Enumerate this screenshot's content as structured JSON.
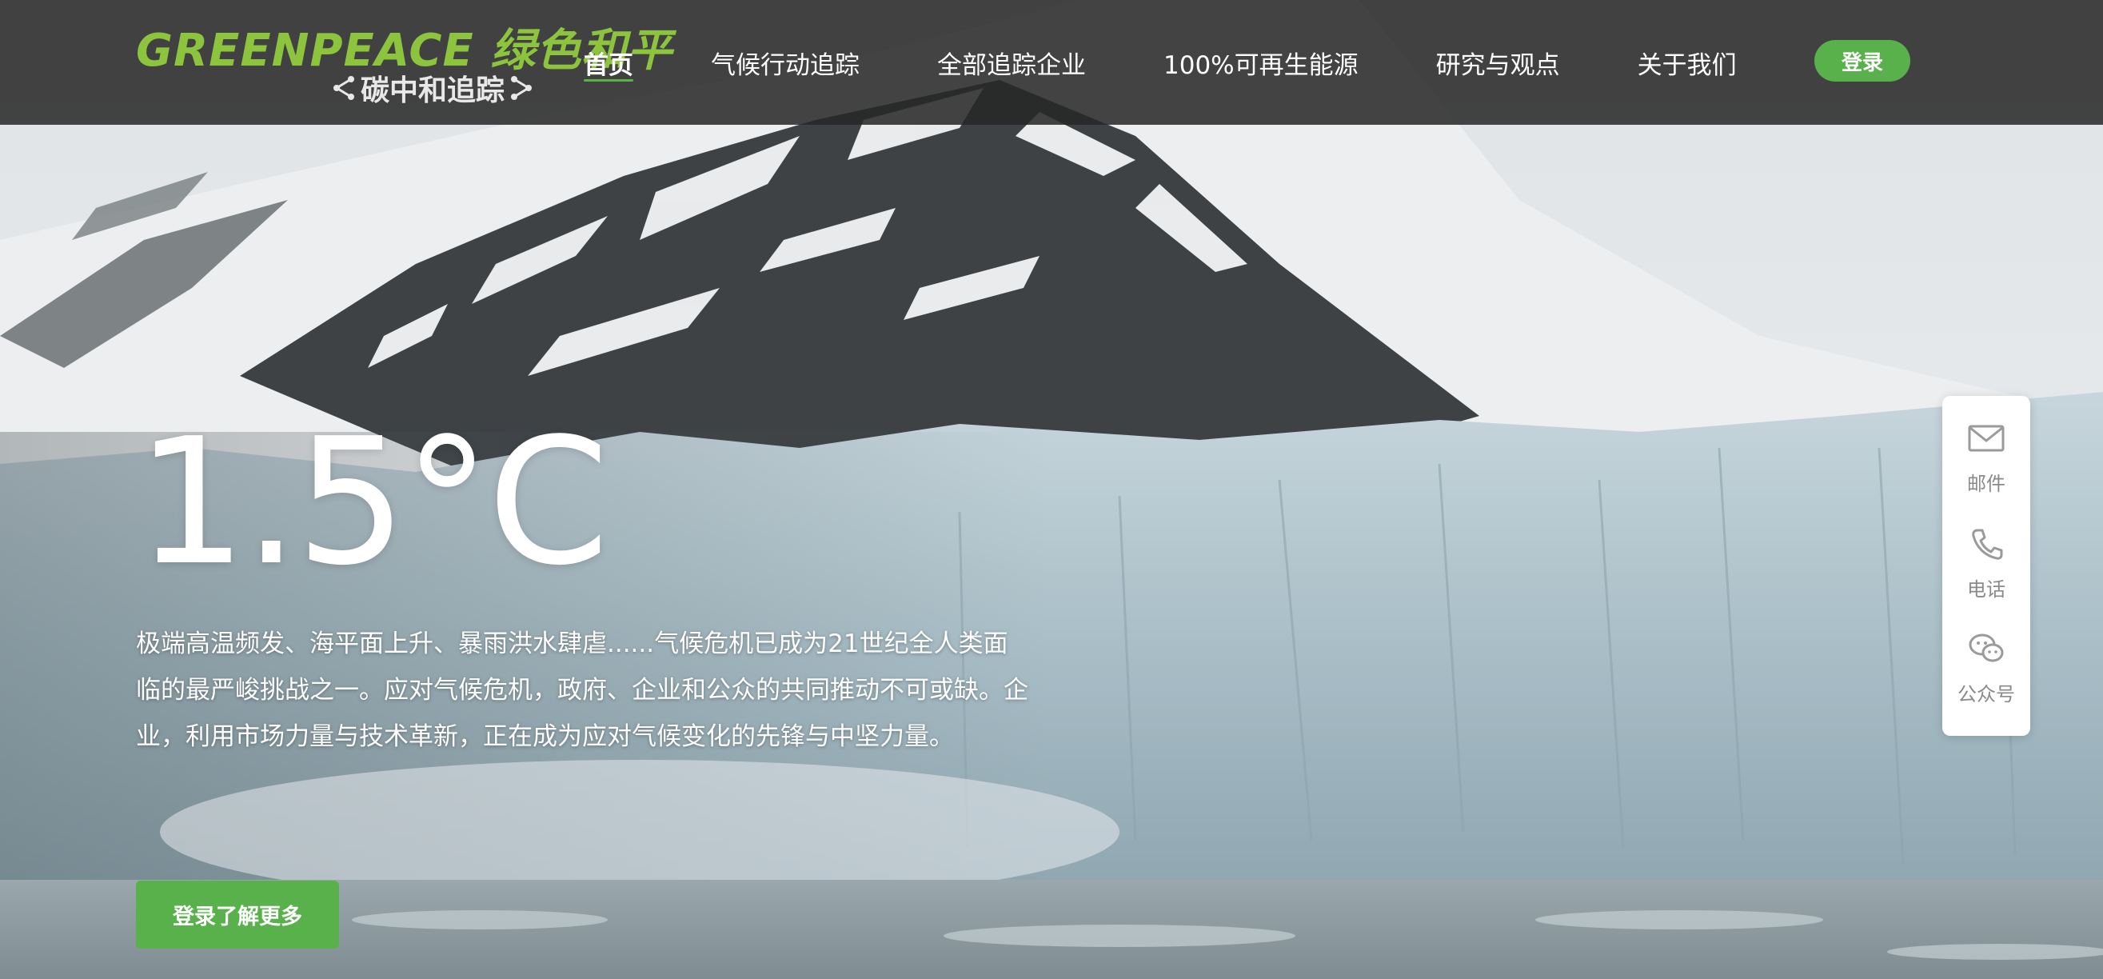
{
  "header": {
    "logo_main": "GREENPEACE 绿色和平",
    "logo_sub": "碳中和追踪",
    "nav": [
      {
        "label": "首页",
        "active": true
      },
      {
        "label": "气候行动追踪",
        "active": false
      },
      {
        "label": "全部追踪企业",
        "active": false
      },
      {
        "label": "100%可再生能源",
        "active": false
      },
      {
        "label": "研究与观点",
        "active": false
      },
      {
        "label": "关于我们",
        "active": false
      }
    ],
    "login_label": "登录"
  },
  "hero": {
    "title": "1.5°C",
    "description": "极端高温频发、海平面上升、暴雨洪水肆虐......气候危机已成为21世纪全人类面临的最严峻挑战之一。应对气候危机，政府、企业和公众的共同推动不可或缺。企业，利用市场力量与技术革新，正在成为应对气候变化的先锋与中坚力量。",
    "cta_label": "登录了解更多"
  },
  "side_panel": {
    "items": [
      {
        "label": "邮件",
        "icon": "mail-icon"
      },
      {
        "label": "电话",
        "icon": "phone-icon"
      },
      {
        "label": "公众号",
        "icon": "wechat-icon"
      }
    ]
  },
  "colors": {
    "brand_green": "#8cc43e",
    "button_green": "#58b14b",
    "header_bg": "#262626"
  }
}
